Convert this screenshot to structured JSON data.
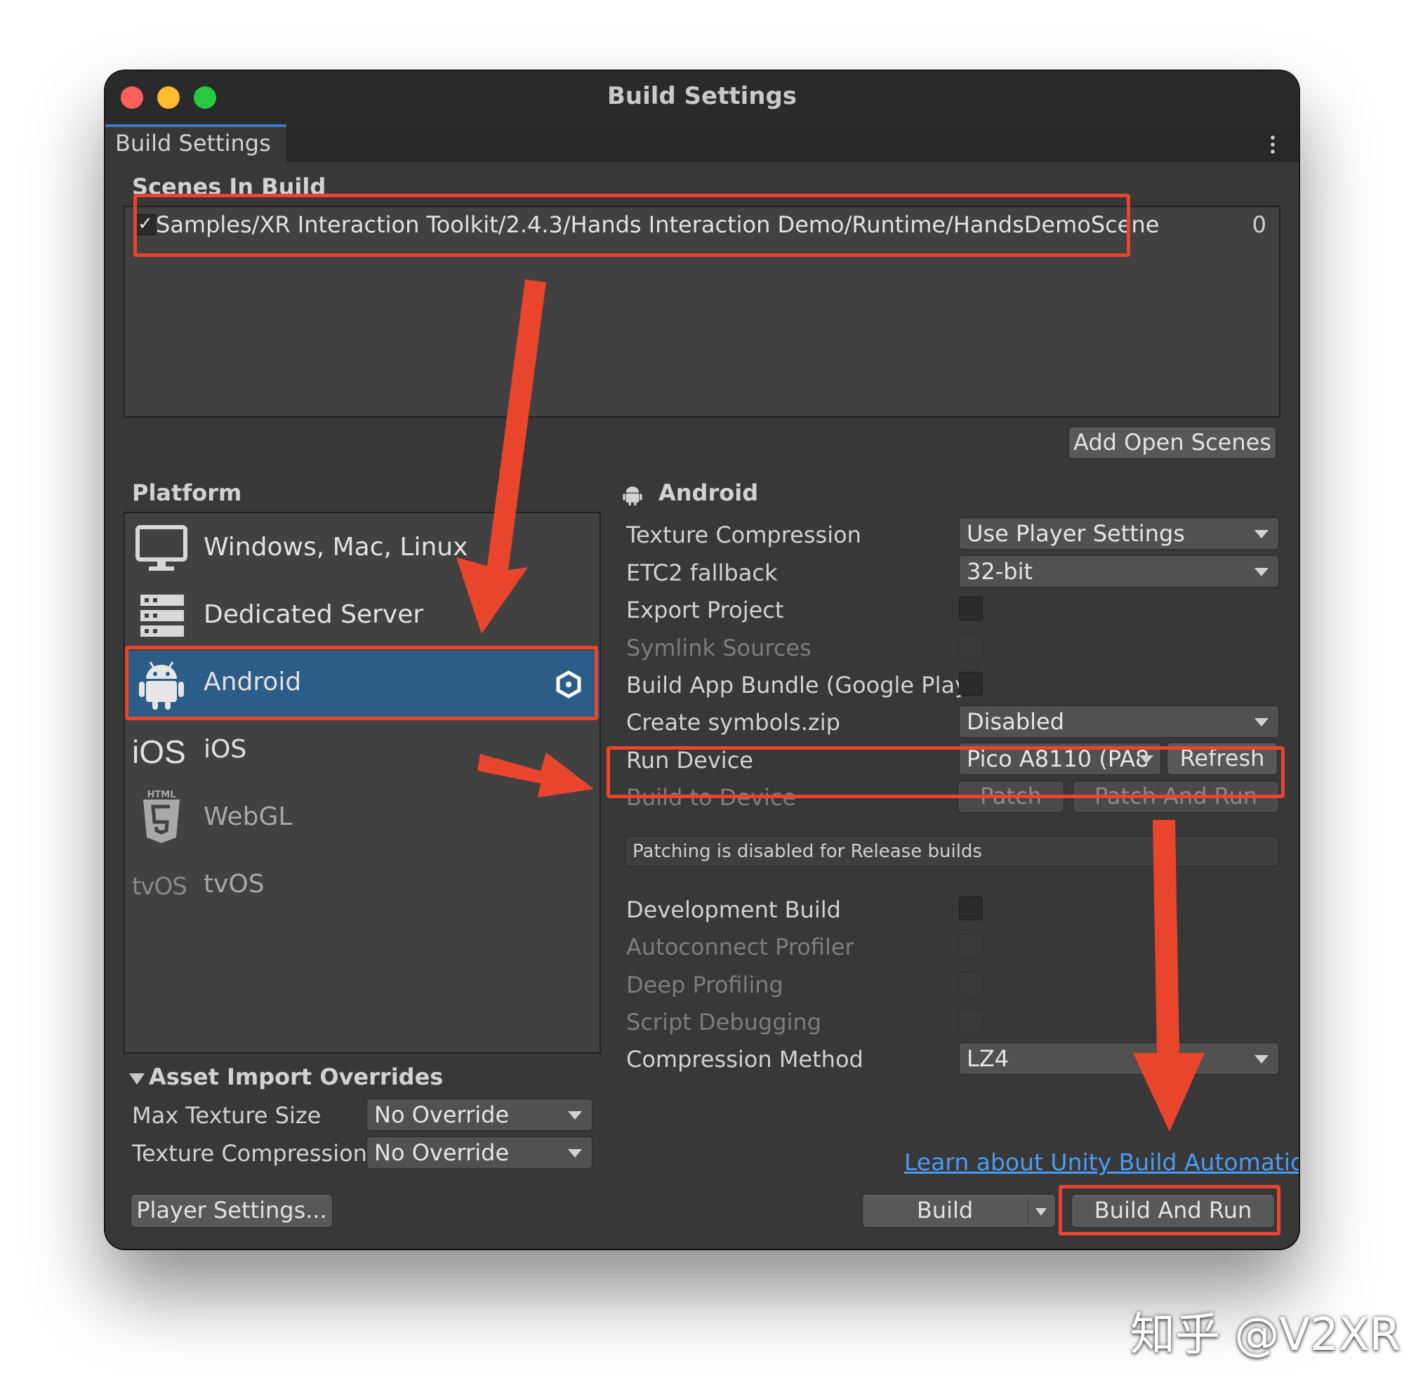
{
  "window": {
    "title": "Build Settings",
    "tab": "Build Settings"
  },
  "scenes": {
    "heading": "Scenes In Build",
    "items": [
      {
        "checked": true,
        "path": "Samples/XR Interaction Toolkit/2.4.3/Hands Interaction Demo/Runtime/HandsDemoScene",
        "index": "0"
      }
    ],
    "add_button": "Add Open Scenes"
  },
  "platform": {
    "heading": "Platform",
    "items": [
      {
        "label": "Windows, Mac, Linux",
        "icon": "monitor-icon"
      },
      {
        "label": "Dedicated Server",
        "icon": "server-icon"
      },
      {
        "label": "Android",
        "icon": "android-icon",
        "selected": true,
        "active_badge": "unity-logo-icon"
      },
      {
        "label": "iOS",
        "icon": "ios-icon",
        "icon_text": "iOS"
      },
      {
        "label": "WebGL",
        "icon": "html5-icon",
        "icon_text": "HTML"
      },
      {
        "label": "tvOS",
        "icon": "tvos-icon",
        "icon_text": "tvOS"
      }
    ]
  },
  "android": {
    "heading": "Android",
    "settings": {
      "texture_compression": {
        "label": "Texture Compression",
        "value": "Use Player Settings"
      },
      "etc2_fallback": {
        "label": "ETC2 fallback",
        "value": "32-bit"
      },
      "export_project": {
        "label": "Export Project",
        "checked": false
      },
      "symlink_sources": {
        "label": "Symlink Sources",
        "checked": false,
        "disabled": true
      },
      "build_app_bundle": {
        "label": "Build App Bundle (Google Play)",
        "checked": false
      },
      "create_symbols": {
        "label": "Create symbols.zip",
        "value": "Disabled"
      },
      "run_device": {
        "label": "Run Device",
        "value": "Pico A8110 (PA8",
        "refresh": "Refresh"
      },
      "build_to_device": {
        "label": "Build to Device",
        "patch": "Patch",
        "patch_and_run": "Patch And Run"
      },
      "info": "Patching is disabled for Release builds",
      "development_build": {
        "label": "Development Build",
        "checked": false
      },
      "autoconnect_profiler": {
        "label": "Autoconnect Profiler",
        "checked": false,
        "disabled": true
      },
      "deep_profiling": {
        "label": "Deep Profiling",
        "checked": false,
        "disabled": true
      },
      "script_debugging": {
        "label": "Script Debugging",
        "checked": false,
        "disabled": true
      },
      "compression_method": {
        "label": "Compression Method",
        "value": "LZ4"
      }
    }
  },
  "asset_import": {
    "heading": "Asset Import Overrides",
    "max_texture_size": {
      "label": "Max Texture Size",
      "value": "No Override"
    },
    "texture_compression": {
      "label": "Texture Compression",
      "value": "No Override"
    }
  },
  "footer": {
    "player_settings": "Player Settings...",
    "learn_link": "Learn about Unity Build Automation",
    "build": "Build",
    "build_and_run": "Build And Run"
  },
  "watermark": "知乎 @V2XR",
  "colors": {
    "annotation": "#e8452c",
    "selection": "#2c5d87",
    "link": "#4c9bf2",
    "background": "#383838"
  }
}
